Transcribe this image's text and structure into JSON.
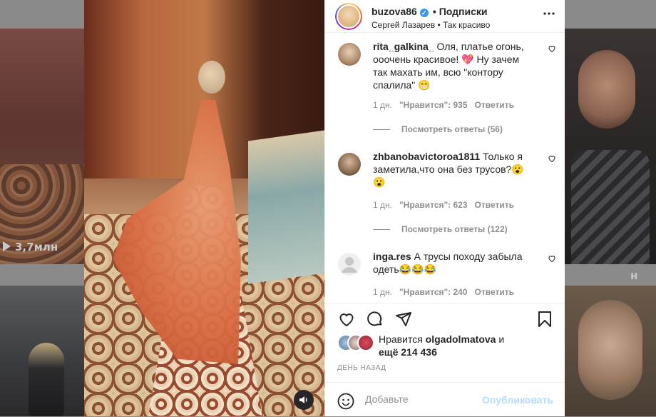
{
  "background": {
    "top_left_views": "3,7млн",
    "top_right_views": "н"
  },
  "post": {
    "username": "buzova86",
    "follow_label": "Подписки",
    "subtitle_left": "Сергей Лазарев",
    "subtitle_sep": "•",
    "subtitle_right": "Так красиво",
    "more_icon": "more-horizontal-icon"
  },
  "comments": [
    {
      "username": "rita_galkina_",
      "text": "Оля, платье огонь, ооочень красивое! 💖 Ну зачем так махать им, всю \"контору спалила\" 😁",
      "time": "1 дн.",
      "likes": "\"Нравится\": 935",
      "reply": "Ответить",
      "replies": "Посмотреть ответы (56)"
    },
    {
      "username": "zhbanobavictoroa1811",
      "text": "Только я заметила,что она без трусов?😮😮",
      "time": "1 дн.",
      "likes": "\"Нравится\": 623",
      "reply": "Ответить",
      "replies": "Посмотреть ответы (122)"
    },
    {
      "username": "inga.res",
      "text": "А трусы походу забыла одеть😂😂😂",
      "time": "1 дн.",
      "likes": "\"Нравится\": 240",
      "reply": "Ответить"
    }
  ],
  "likes": {
    "prefix": "Нравится",
    "user": "olgadolmatova",
    "and": "и",
    "more": "ещё 214 436"
  },
  "date": "ДЕНЬ НАЗАД",
  "add_comment": {
    "placeholder": "Добавьте",
    "publish_label": "Опубликовать"
  },
  "colors": {
    "verified": "#3897f0",
    "publish_disabled": "#b3dbff",
    "meta_gray": "#8e8e8e"
  }
}
